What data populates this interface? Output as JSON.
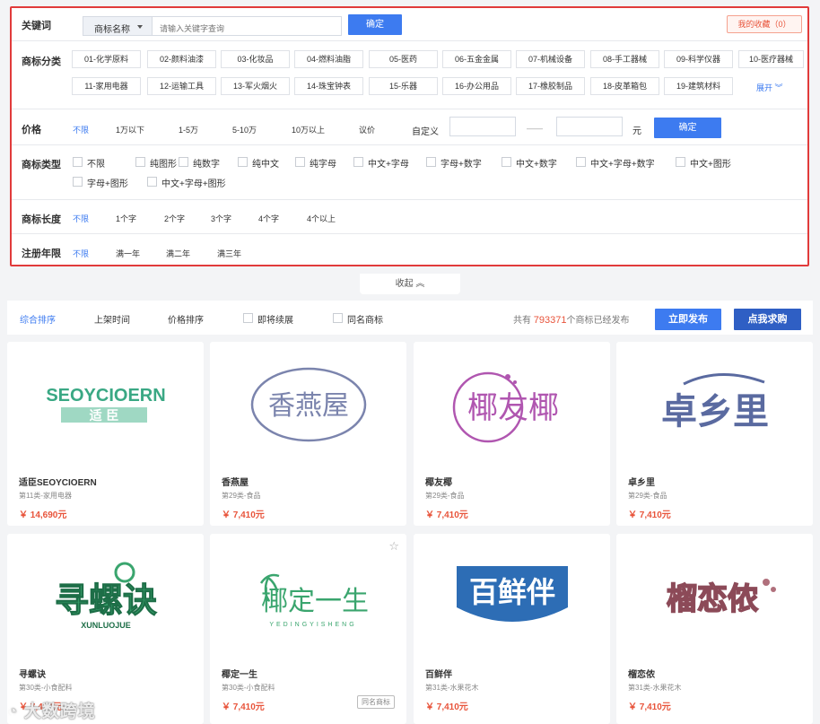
{
  "keyword": {
    "label": "关键词",
    "select": "商标名称",
    "placeholder": "请输入关键字查询",
    "confirm": "确定",
    "favorites": "我的收藏（0）"
  },
  "category": {
    "label": "商标分类",
    "items": [
      "01-化学原料",
      "02-颜料油漆",
      "03-化妆品",
      "04-燃料油脂",
      "05-医药",
      "06-五金金属",
      "07-机械设备",
      "08-手工器械",
      "09-科学仪器",
      "10-医疗器械",
      "11-家用电器",
      "12-运输工具",
      "13-军火烟火",
      "14-珠宝钟表",
      "15-乐器",
      "16-办公用品",
      "17-橡胶制品",
      "18-皮革箱包",
      "19-建筑材料"
    ],
    "expand": "展开"
  },
  "price": {
    "label": "价格",
    "options": [
      "不限",
      "1万以下",
      "1-5万",
      "5-10万",
      "10万以上",
      "议价"
    ],
    "custom": "自定义",
    "dash": "——",
    "unit": "元",
    "confirm": "确定"
  },
  "type": {
    "label": "商标类型",
    "options": [
      "不限",
      "纯图形",
      "纯数字",
      "纯中文",
      "纯字母",
      "中文+字母",
      "字母+数字",
      "中文+数字",
      "中文+字母+数字",
      "中文+图形",
      "字母+图形",
      "中文+字母+图形"
    ]
  },
  "length": {
    "label": "商标长度",
    "options": [
      "不限",
      "1个字",
      "2个字",
      "3个字",
      "4个字",
      "4个以上"
    ]
  },
  "years": {
    "label": "注册年限",
    "options": [
      "不限",
      "满一年",
      "满二年",
      "满三年"
    ]
  },
  "collapse": "收起",
  "sort": {
    "items": [
      "综合排序",
      "上架时间",
      "价格排序"
    ],
    "checks": [
      "即将续展",
      "同名商标"
    ],
    "total_prefix": "共有",
    "total": "793371",
    "total_suffix": "个商标已经发布",
    "publish": "立即发布",
    "buy": "点我求购"
  },
  "cards": [
    {
      "name": "适臣SEOYCIOERN",
      "cls": "第11类-家用电器",
      "price": "￥ 14,690元",
      "logo_en": "SEOYCIOERN",
      "logo_cn": "适 臣"
    },
    {
      "name": "香燕屋",
      "cls": "第29类-食品",
      "price": "￥ 7,410元",
      "logo": "香燕屋"
    },
    {
      "name": "椰友椰",
      "cls": "第29类-食品",
      "price": "￥ 7,410元",
      "logo": "椰友椰"
    },
    {
      "name": "卓乡里",
      "cls": "第29类-食品",
      "price": "￥ 7,410元",
      "logo": "卓乡里"
    },
    {
      "name": "寻螺诀",
      "cls": "第30类-小食配料",
      "price": "￥ 7,410元",
      "logo": "寻螺诀",
      "logo_sub": "XUNLUOJUE"
    },
    {
      "name": "椰定一生",
      "cls": "第30类-小食配料",
      "price": "￥ 7,410元",
      "logo": "椰定一生",
      "logo_sub": "YEDINGYISHENG",
      "tag": "同名商标"
    },
    {
      "name": "百鲜伴",
      "cls": "第31类-水果花木",
      "price": "￥ 7,410元",
      "logo": "百鲜伴"
    },
    {
      "name": "榴恋侬",
      "cls": "第31类-水果花木",
      "price": "￥ 7,410元",
      "logo": "榴恋侬"
    }
  ],
  "watermark": "大数跨境",
  "colors": {
    "accent": "#3d7bf0",
    "price": "#e8543b",
    "highlight_border": "#e13b3b"
  }
}
